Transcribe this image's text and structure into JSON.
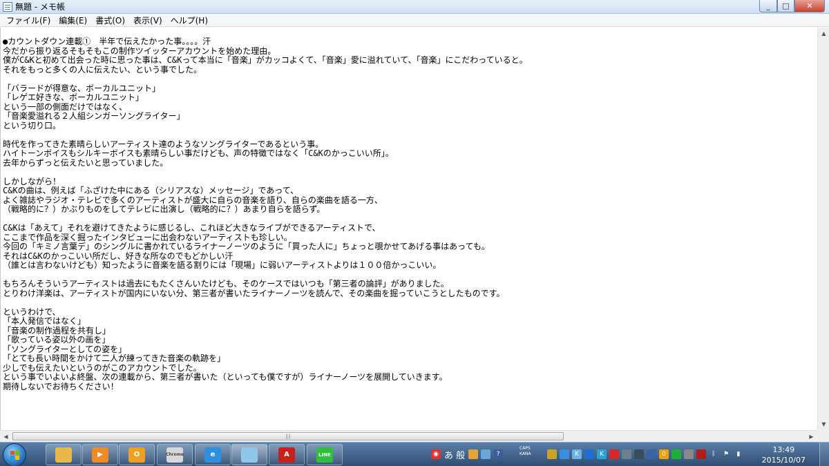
{
  "window": {
    "title": "無題 - メモ帳",
    "minimize": "_",
    "maximize": "□",
    "close": "✕"
  },
  "menu": [
    "ファイル(F)",
    "編集(E)",
    "書式(O)",
    "表示(V)",
    "ヘルプ(H)"
  ],
  "editor": {
    "text": "●カウントダウン連載①　半年で伝えたかった事。。。。汗\n今だから振り返るそもそもこの制作ツイッターアカウントを始めた理由。\n僕がC&Kと初めて出会った時に思った事は、C&Kって本当に「音楽」がカッコよくて、「音楽」愛に溢れていて、「音楽」にこだわっていると。\nそれをもっと多くの人に伝えたい、という事でした。\n\n「バラードが得意な、ボーカルユニット」\n「レゲエ好きな、ボーカルユニット」\nという一部の側面だけではなく、\n「音楽愛溢れる２人組シンガーソングライター」\nという切り口。\n\n時代を作ってきた素晴らしいアーティスト達のようなソングライターであるという事。\nハイトーンボイスもシルキーボイスも素晴らしい事だけども、声の特徴ではなく「C&Kのかっこいい所」。\n去年からずっと伝えたいと思っていました。\n\nしかしながら！\nC&Kの曲は、例えば「ふざけた中にある（シリアスな）メッセージ」であって、\nよく雑誌やラジオ・テレビで多くのアーティストが盛大に自らの音楽を語り、自らの楽曲を語る一方、\n（戦略的に？）かぶりものをしてテレビに出演し（戦略的に？）あまり自らを語らず。\n\nC&Kは「あえて」それを避けてきたように感じるし、これほど大きなライブができるアーティストで、\nここまで作品を深く掘ったインタビューに出会わないアーティストも珍しい。\n今回の「キミノ言葉デ」のシングルに書かれているライナーノーツのように「買った人に」ちょっと覗かせてあげる事はあっても。\nそれはC&Kのかっこいい所だし、好きな所なのでもどかしい汗\n（誰とは言わないけども）知ったように音楽を語る割りには「現場」に弱いアーティストよりは１００倍かっこいい。\n\nもちろんそういうアーティストは過去にもたくさんいたけども、そのケースではいつも「第三者の論評」がありました。\nとりわけ洋楽は、アーティストが国内にいない分、第三者が書いたライナーノーツを読んで、その楽曲を掘っていこうとしたものです。\n\nというわけで、\n「本人発信ではなく」\n「音楽の制作過程を共有し」\n「歌っている姿以外の画を」\n「ソングライターとしての姿を」\n「とても長い時間をかけて二人が練ってきた音楽の軌跡を」\n少しでも伝えたいというのがこのアカウントでした。\nという事でいよいよ終盤、次の連載から、第三者が書いた（といっても僕ですが）ライナーノーツを展開していきます。\n期待しないでお待ちください！"
  },
  "taskbar": {
    "apps": [
      {
        "name": "explorer",
        "color": "#e8b84a",
        "label": ""
      },
      {
        "name": "media-player",
        "color": "#f08a24",
        "label": "▶"
      },
      {
        "name": "outlook",
        "color": "#f0a020",
        "label": "O"
      },
      {
        "name": "chrome",
        "color": "#d8d8d8",
        "label": "Chrome"
      },
      {
        "name": "internet-explorer",
        "color": "#2f8ee0",
        "label": "e"
      },
      {
        "name": "notepad",
        "color": "#8fc6ea",
        "label": ""
      },
      {
        "name": "acrobat",
        "color": "#c8201c",
        "label": "A"
      },
      {
        "name": "line",
        "color": "#2fbf3a",
        "label": "LINE"
      }
    ],
    "ime": "あ 般",
    "caps": "CAPS",
    "kana": "KANA",
    "time": "13:49",
    "date": "2015/10/07"
  }
}
